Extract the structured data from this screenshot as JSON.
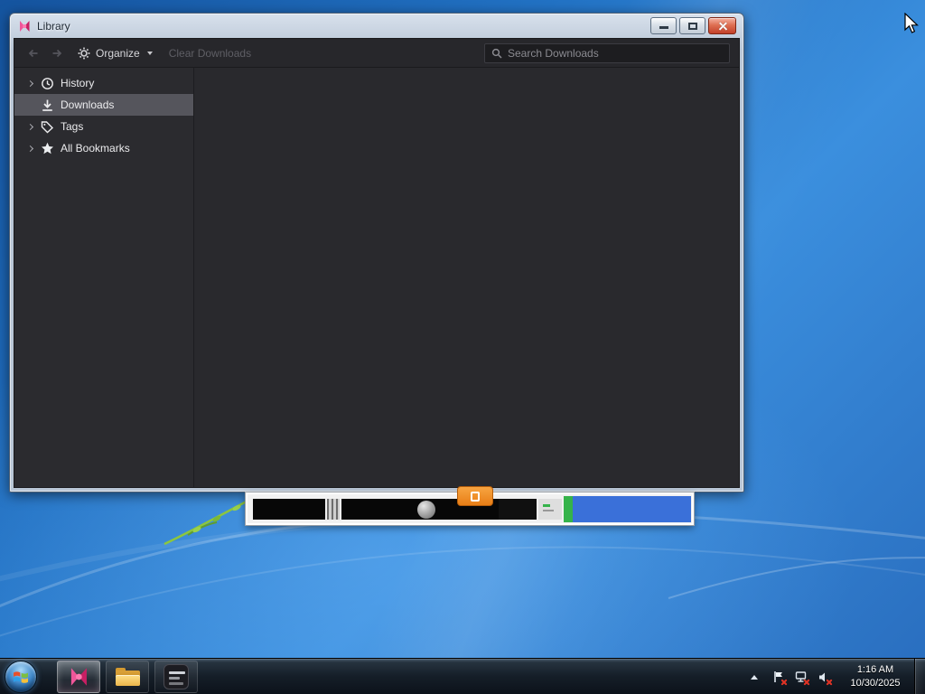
{
  "window": {
    "title": "Library"
  },
  "toolbar": {
    "organize_label": "Organize",
    "clear_downloads_label": "Clear Downloads",
    "search_placeholder": "Search Downloads"
  },
  "sidebar": {
    "items": [
      {
        "label": "History"
      },
      {
        "label": "Downloads"
      },
      {
        "label": "Tags"
      },
      {
        "label": "All Bookmarks"
      }
    ]
  },
  "taskbar": {
    "clock": {
      "time": "1:16 AM",
      "date": "10/30/2025"
    }
  },
  "icons": {
    "app": "pink-ribbon-icon",
    "history": "clock-icon",
    "downloads": "download-icon",
    "tags": "tag-icon",
    "all_bookmarks": "star-icon",
    "organize": "gear-icon",
    "search": "magnifier-icon",
    "tray": [
      "flag-icon",
      "network-icon",
      "volume-icon"
    ]
  },
  "colors": {
    "selection": "#55555c",
    "panel_dark": "#29292d",
    "accent_pink": "#e44b8d",
    "close_red": "#c2412a",
    "orange_button": "#ee8a1e",
    "green_bar": "#35b34a",
    "blue_panel": "#3a70d9",
    "desktop_blue": "#2a7fd4"
  }
}
